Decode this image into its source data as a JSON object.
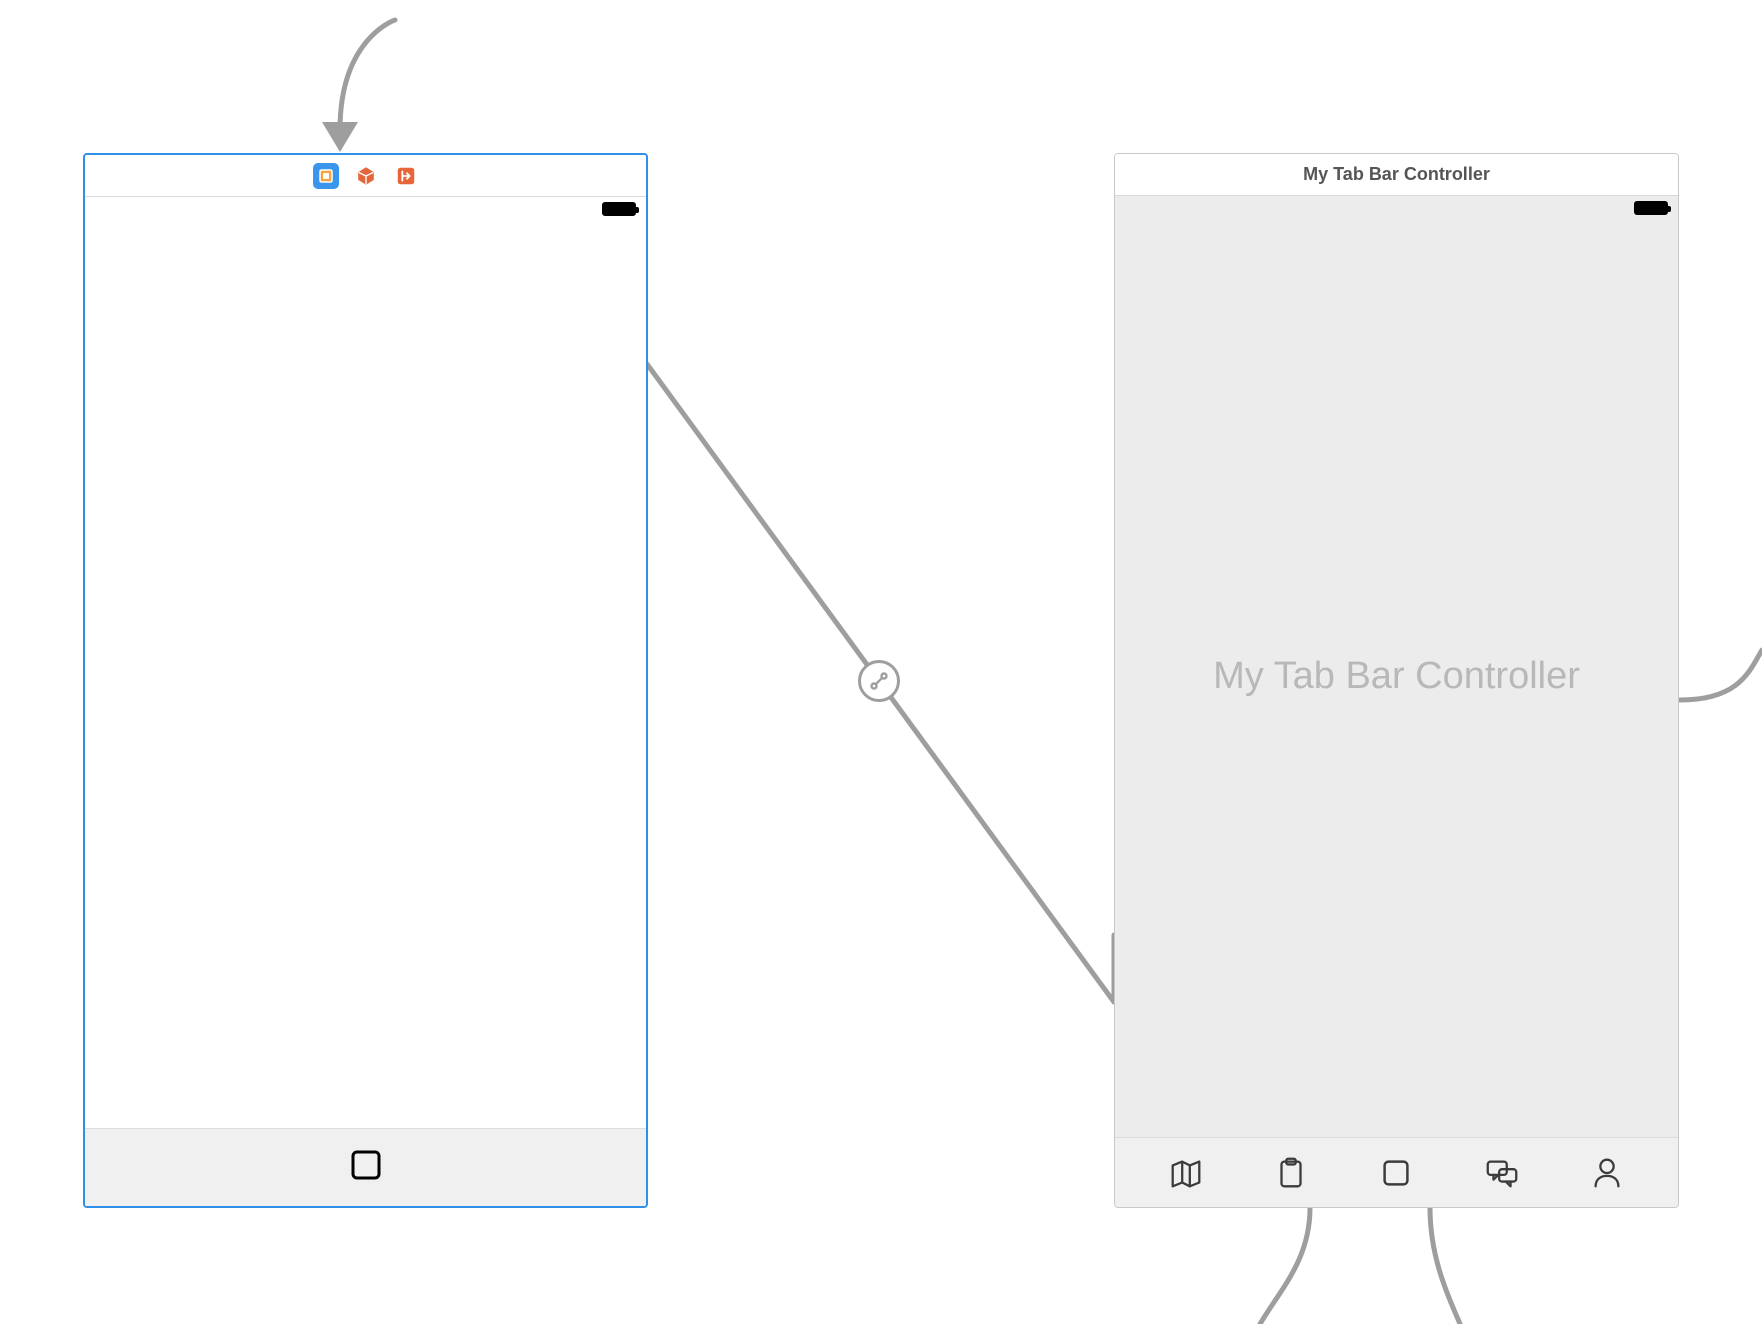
{
  "scene_left": {
    "header_icons": [
      "view-controller-icon",
      "box-3d-icon",
      "exit-icon"
    ]
  },
  "scene_right": {
    "title": "My Tab Bar Controller",
    "placeholder": "My Tab Bar Controller",
    "tabs": [
      "map-icon",
      "clipboard-icon",
      "square-icon",
      "chat-icon",
      "person-icon"
    ]
  }
}
